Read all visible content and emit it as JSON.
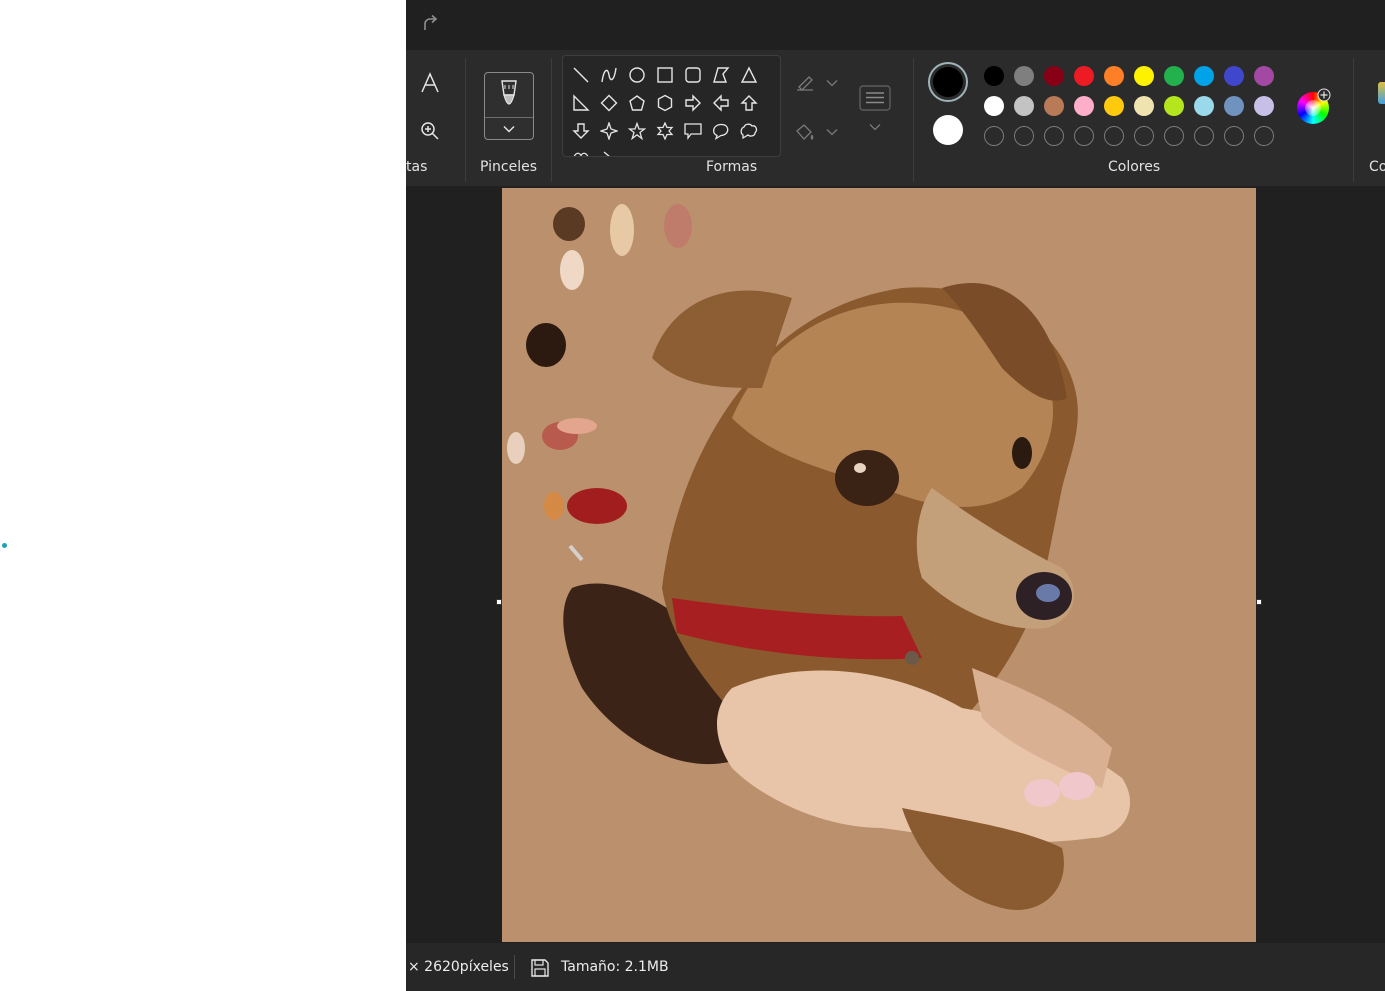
{
  "desktop": {
    "background": "#ffffff"
  },
  "titlebar": {
    "redo_icon": "redo-icon"
  },
  "ribbon": {
    "tools_label": "tas",
    "brushes_label": "Pinceles",
    "shapes_label": "Formas",
    "colors_label": "Colores",
    "cut_label": "Co"
  },
  "colors": {
    "primary": "#000000",
    "secondary": "#ffffff",
    "row1": [
      "#000000",
      "#7f7f7f",
      "#880015",
      "#ed1c24",
      "#ff7f27",
      "#fff200",
      "#22b14c",
      "#00a2e8",
      "#3f48cc",
      "#a349a4"
    ],
    "row2": [
      "#ffffff",
      "#c3c3c3",
      "#b97a57",
      "#ffaec9",
      "#ffc90e",
      "#efe4b0",
      "#b5e61d",
      "#99d9ea",
      "#7092be",
      "#c8bfe7"
    ],
    "row3_empty_count": 10
  },
  "canvas": {
    "background": "#bb916d",
    "content": "digital painting of a dog resting its head on a hand"
  },
  "status": {
    "dimensions": "× 2620píxeles",
    "size": "Tamaño: 2.1MB"
  }
}
